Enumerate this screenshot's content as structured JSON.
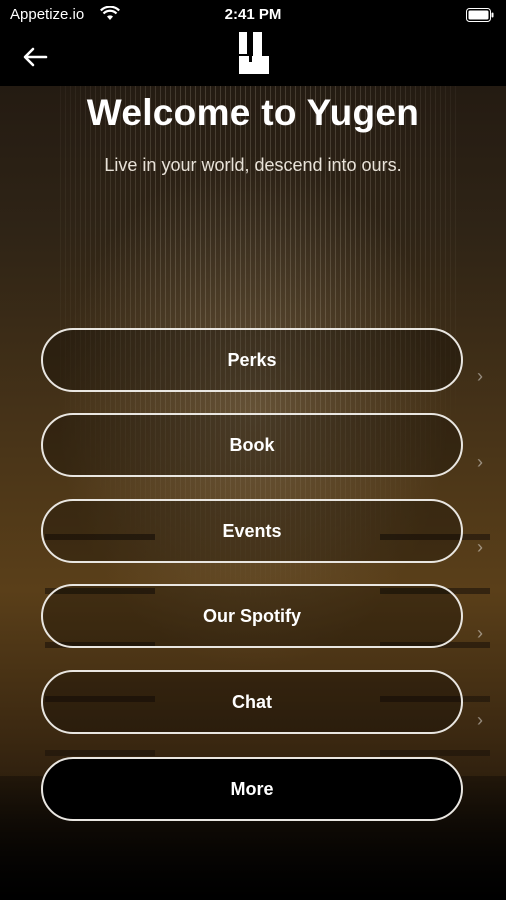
{
  "status_bar": {
    "carrier": "Appetize.io",
    "time": "2:41 PM"
  },
  "nav": {
    "back_icon": "arrow-left-icon",
    "logo_icon": "yugen-logo"
  },
  "header": {
    "title": "Welcome to Yugen",
    "subtitle": "Live in your world, descend into ours."
  },
  "menu": {
    "items": [
      {
        "label": "Perks"
      },
      {
        "label": "Book"
      },
      {
        "label": "Events"
      },
      {
        "label": "Our Spotify"
      },
      {
        "label": "Chat"
      },
      {
        "label": "More"
      }
    ]
  },
  "colors": {
    "background": "#000000",
    "button_border": "#e9e6e1",
    "text": "#ffffff"
  }
}
